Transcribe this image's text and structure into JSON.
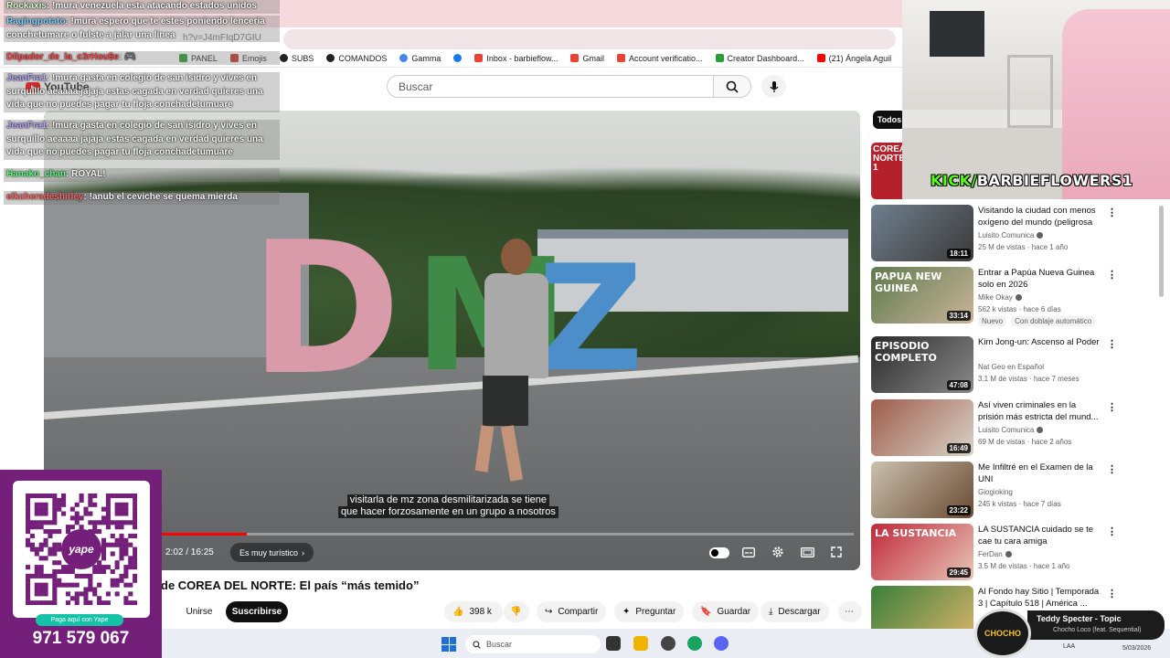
{
  "browser": {
    "url_fragment": "h?v=J4mFIqD7GIU",
    "bookmarks": [
      "PANEL",
      "Emojis",
      "SUBS",
      "COMANDOS",
      "Gamma",
      "Inbox - barbieflow...",
      "Gmail",
      "Account verificatio...",
      "Creator Dashboard...",
      "(21) Ángela Aguil"
    ]
  },
  "youtube": {
    "logo": "YouTube",
    "search_placeholder": "Buscar"
  },
  "player": {
    "caption_line1": "visitarla de mz zona desmilitarizada se tiene",
    "caption_line2": "que hacer forzosamente en un grupo a nosotros",
    "time": "2:02 / 16:25",
    "progress": 0.124,
    "chapter": "Es muy turístico",
    "sign_letters": [
      "D",
      "M",
      "Z"
    ]
  },
  "video": {
    "title": "de COREA DEL NORTE: El país “más temido”",
    "join_label": "Unirse",
    "subscribe_label": "Suscribirse",
    "likes": "398 k",
    "share_label": "Compartir",
    "ask_label": "Preguntar",
    "save_label": "Guardar",
    "download_label": "Descargar"
  },
  "sidebar": {
    "chip_all": "Todos",
    "first_thumb_text": "COREA NORTE 1",
    "recommendations": [
      {
        "title": "Visitando la ciudad con menos oxígeno del mundo (peligrosa ...",
        "channel": "Luisito Comunica",
        "verified": true,
        "meta": "25 M de vistas · hace 1 año",
        "duration": "18:11",
        "thumb_text": "",
        "colors": [
          "#6f7f8e",
          "#3b3a38"
        ]
      },
      {
        "title": "Entrar a Papúa Nueva Guinea solo en 2026",
        "channel": "Mike Okay",
        "verified": true,
        "meta": "562 k vistas · hace 6 días",
        "duration": "33:14",
        "thumb_text": "PAPUA NEW GUINEA",
        "badges": [
          "Nuevo",
          "Con doblaje automático"
        ],
        "colors": [
          "#5e7a4c",
          "#c9b59a"
        ]
      },
      {
        "title": "Kim Jong-un: Ascenso al Poder",
        "channel": "Nat Geo en Español",
        "verified": false,
        "meta": "3.1 M de vistas · hace 7 meses",
        "duration": "47:08",
        "thumb_text": "EPISODIO COMPLETO",
        "colors": [
          "#2a2a2a",
          "#8a8a8a"
        ]
      },
      {
        "title": "Así viven criminales en la prisión más estricta del mund...",
        "channel": "Luisito Comunica",
        "verified": true,
        "meta": "69 M de vistas · hace 2 años",
        "duration": "16:49",
        "thumb_text": "",
        "colors": [
          "#9f5c4a",
          "#d9d3c9"
        ]
      },
      {
        "title": "Me Infiltré en el Examen de la UNI",
        "channel": "Giogioking",
        "verified": false,
        "meta": "245 k vistas · hace 7 días",
        "duration": "23:22",
        "thumb_text": "",
        "colors": [
          "#c9c1ad",
          "#6a4a33"
        ]
      },
      {
        "title": "LA SUSTANCIA cuidado se te cae tu cara amiga",
        "channel": "FerDan",
        "verified": true,
        "meta": "3.5 M de vistas · hace 1 año",
        "duration": "29:45",
        "thumb_text": "LA SUSTANCIA",
        "colors": [
          "#c0283a",
          "#e8c7b8"
        ]
      },
      {
        "title": "Al Fondo hay Sitio | Temporada 3 | Capítulo 518 | América ...",
        "channel": "",
        "verified": false,
        "meta": "",
        "duration": "",
        "thumb_text": "",
        "colors": [
          "#3a7f3a",
          "#d9b36a"
        ]
      }
    ]
  },
  "webcam": {
    "kick_prefix": "KICK/",
    "kick_name": "BARBIEFLOWERS1"
  },
  "chat": [
    {
      "user": "Rockaxis",
      "text": "!mura venezuela esta atacando estados unidos",
      "user_color": "#d7ffd0"
    },
    {
      "user": "Ragingpotato",
      "text": "!mura espero que te estes poniendo lenceria conchetumare o fulste a jalar una linea",
      "user_color": "#7fd3ff"
    },
    {
      "user": "Dilpador_de_la_c3rHou$e",
      "text": "🎮",
      "user_color": "#ff4b4b"
    },
    {
      "user": "JeanFra1",
      "text": "!mura gasta en colegio de san isidro y vives en surquillo aeaaaa jajaja estas cagada en verdad quieres una vida que no puedes pagar tu floja conchadetumuare",
      "user_color": "#b9a7ff"
    },
    {
      "user": "JeanFra1",
      "text": "!mura gasta en colegio de san isidro y vives en surquillo aeaaaa jajaja estas cagada en verdad quieres una vida que no puedes pagar tu floja conchadetumuare",
      "user_color": "#b9a7ff"
    },
    {
      "user": "Hanako_chan",
      "text": "ROYAL!",
      "user_color": "#5cff7a"
    },
    {
      "user": "elkcheradeshirley",
      "text": "!anub el ceviche se quema mierda",
      "user_color": "#ff6a6a"
    }
  ],
  "yape": {
    "brand": "yape",
    "pill": "Paga aquí con Yape",
    "phone": "971 579 067"
  },
  "now_playing": {
    "disc_text": "CHOCHO",
    "title": "Teddy Specter - Topic",
    "artist": "Chocho Loco (feat. Sequential)"
  },
  "taskbar": {
    "search_placeholder": "Buscar",
    "tray": "LAA",
    "date": "5/03/2026"
  },
  "colors": {
    "yt_red": "#ff0000",
    "yape_purple": "#741f7a",
    "kick_green": "#53fc18"
  }
}
